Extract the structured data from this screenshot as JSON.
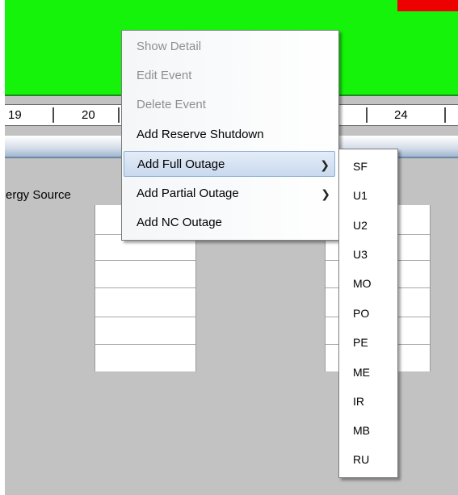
{
  "ruler": {
    "labels": [
      "19",
      "20",
      "24"
    ]
  },
  "background": {
    "energy_source_label": "ergy Source"
  },
  "context_menu": {
    "items": [
      {
        "label": "Show Detail",
        "enabled": false
      },
      {
        "label": "Edit Event",
        "enabled": false
      },
      {
        "label": "Delete Event",
        "enabled": false
      },
      {
        "label": "Add Reserve Shutdown",
        "enabled": true
      },
      {
        "label": "Add Full Outage",
        "enabled": true,
        "submenu": true,
        "highlighted": true
      },
      {
        "label": "Add Partial Outage",
        "enabled": true,
        "submenu": true
      },
      {
        "label": "Add NC Outage",
        "enabled": true
      }
    ],
    "submenu_arrow": "chevron-right-icon"
  },
  "submenu": {
    "items": [
      "SF",
      "U1",
      "U2",
      "U3",
      "MO",
      "PO",
      "PE",
      "ME",
      "IR",
      "MB",
      "RU"
    ]
  },
  "colors": {
    "green_band": "#15f30a",
    "red_block": "#ee0000",
    "highlight": "#c9d9ee",
    "disabled_text": "#8f8f8f",
    "background_gray": "#c2c2c2"
  }
}
